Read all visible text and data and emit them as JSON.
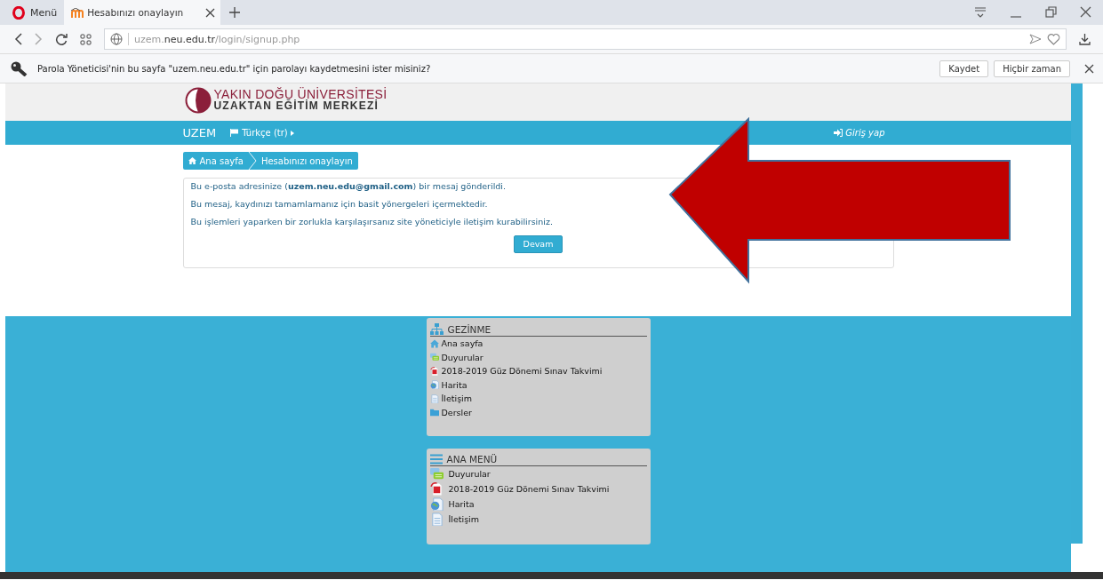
{
  "browser": {
    "tabs": [
      {
        "kind": "menu",
        "label": "Menü",
        "selected": false
      },
      {
        "kind": "page",
        "label": "Hesabınızı onaylayın",
        "selected": true
      }
    ],
    "address": {
      "host_prefix": "uzem.",
      "host": "neu.edu.tr",
      "path": "/login/signup.php"
    },
    "password_bar": {
      "message": "Parola Yöneticisi'nin bu sayfa \"uzem.neu.edu.tr\" için parolayı kaydetmesini ister misiniz?",
      "buttons": [
        "Kaydet",
        "Hiçbir zaman"
      ]
    }
  },
  "site": {
    "logo": [
      "YAKIN DOĞU ÜNİVERSİTESİ",
      "UZAKTAN EĞİTİM MERKEZİ"
    ],
    "navbar": {
      "brand": "UZEM",
      "language": "Türkçe (tr)",
      "login": "Giriş yap"
    },
    "breadcrumb": [
      "Ana sayfa",
      "Hesabınızı onaylayın"
    ],
    "message": [
      "Bu e-posta adresinize (**uzem.neu.edu@gmail.com**) bir mesaj gönderildi.",
      "Bu mesaj, kaydınızı tamamlamanız için basit yönergeleri içermektedir.",
      "Bu işlemleri yaparken bir zorlukla karşılaşırsanız site yöneticiyle iletişim kurabilirsiniz."
    ],
    "continue_button": "Devam",
    "blocks": [
      {
        "kind": "navigation",
        "title": "GEZİNME",
        "items": [
          {
            "kind": "home",
            "label": "Ana sayfa"
          },
          {
            "kind": "chat",
            "label": "Duyurular"
          },
          {
            "kind": "pdf",
            "label": "2018-2019 Güz Dönemi Sınav Takvimi"
          },
          {
            "kind": "globe",
            "label": "Harita"
          },
          {
            "kind": "doc",
            "label": "İletişim"
          },
          {
            "kind": "folder",
            "label": "Dersler"
          }
        ]
      },
      {
        "kind": "menu",
        "title": "ANA MENÜ",
        "items": [
          {
            "kind": "chat",
            "label": "Duyurular"
          },
          {
            "kind": "pdf",
            "label": "2018-2019 Güz Dönemi Sınav Takvimi"
          },
          {
            "kind": "globe",
            "label": "Harita"
          },
          {
            "kind": "doc",
            "label": "İletişim"
          }
        ]
      }
    ]
  }
}
